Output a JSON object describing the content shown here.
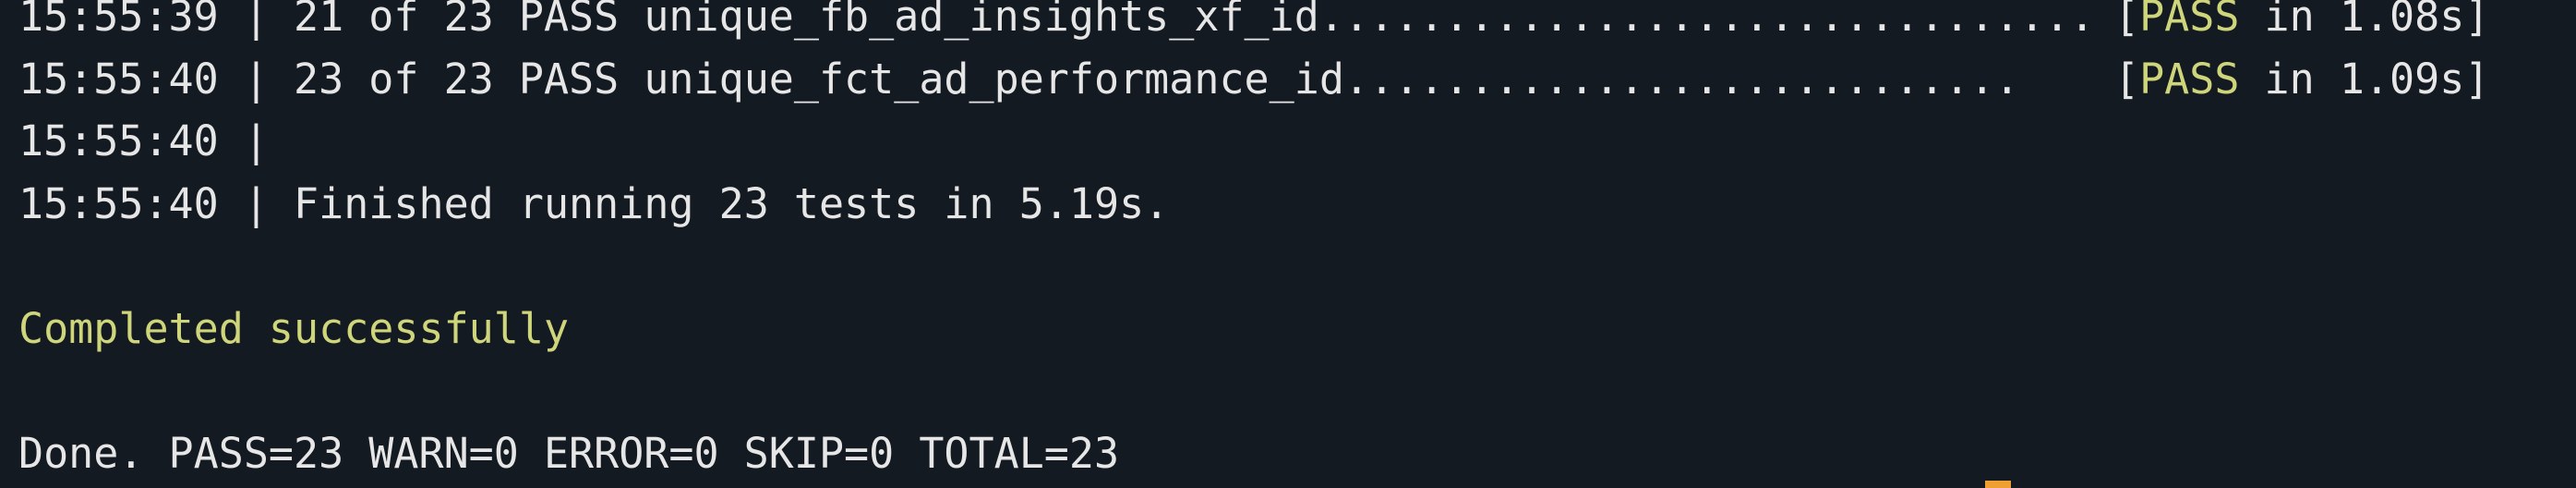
{
  "terminal": {
    "lines": [
      {
        "time": "15:55:39",
        "sep": " | ",
        "text": "21 of 23 PASS unique_fb_ad_insights_xf_id...............................",
        "result_open": "[",
        "result_status": "PASS",
        "result_tail": " in 1.08s]"
      },
      {
        "time": "15:55:40",
        "sep": " | ",
        "text": "23 of 23 PASS unique_fct_ad_performance_id...........................",
        "result_open": "[",
        "result_status": "PASS",
        "result_tail": " in 1.09s]"
      },
      {
        "time": "15:55:40",
        "sep": " |",
        "text": ""
      },
      {
        "time": "15:55:40",
        "sep": " | ",
        "text": "Finished running 23 tests in 5.19s."
      }
    ],
    "status_message": "Completed successfully",
    "summary": "Done. PASS=23 WARN=0 ERROR=0 SKIP=0 TOTAL=23"
  },
  "colors": {
    "background": "#141a22",
    "text": "#e6e6e6",
    "pass": "#cfd57a",
    "cursor": "#f0a030"
  }
}
